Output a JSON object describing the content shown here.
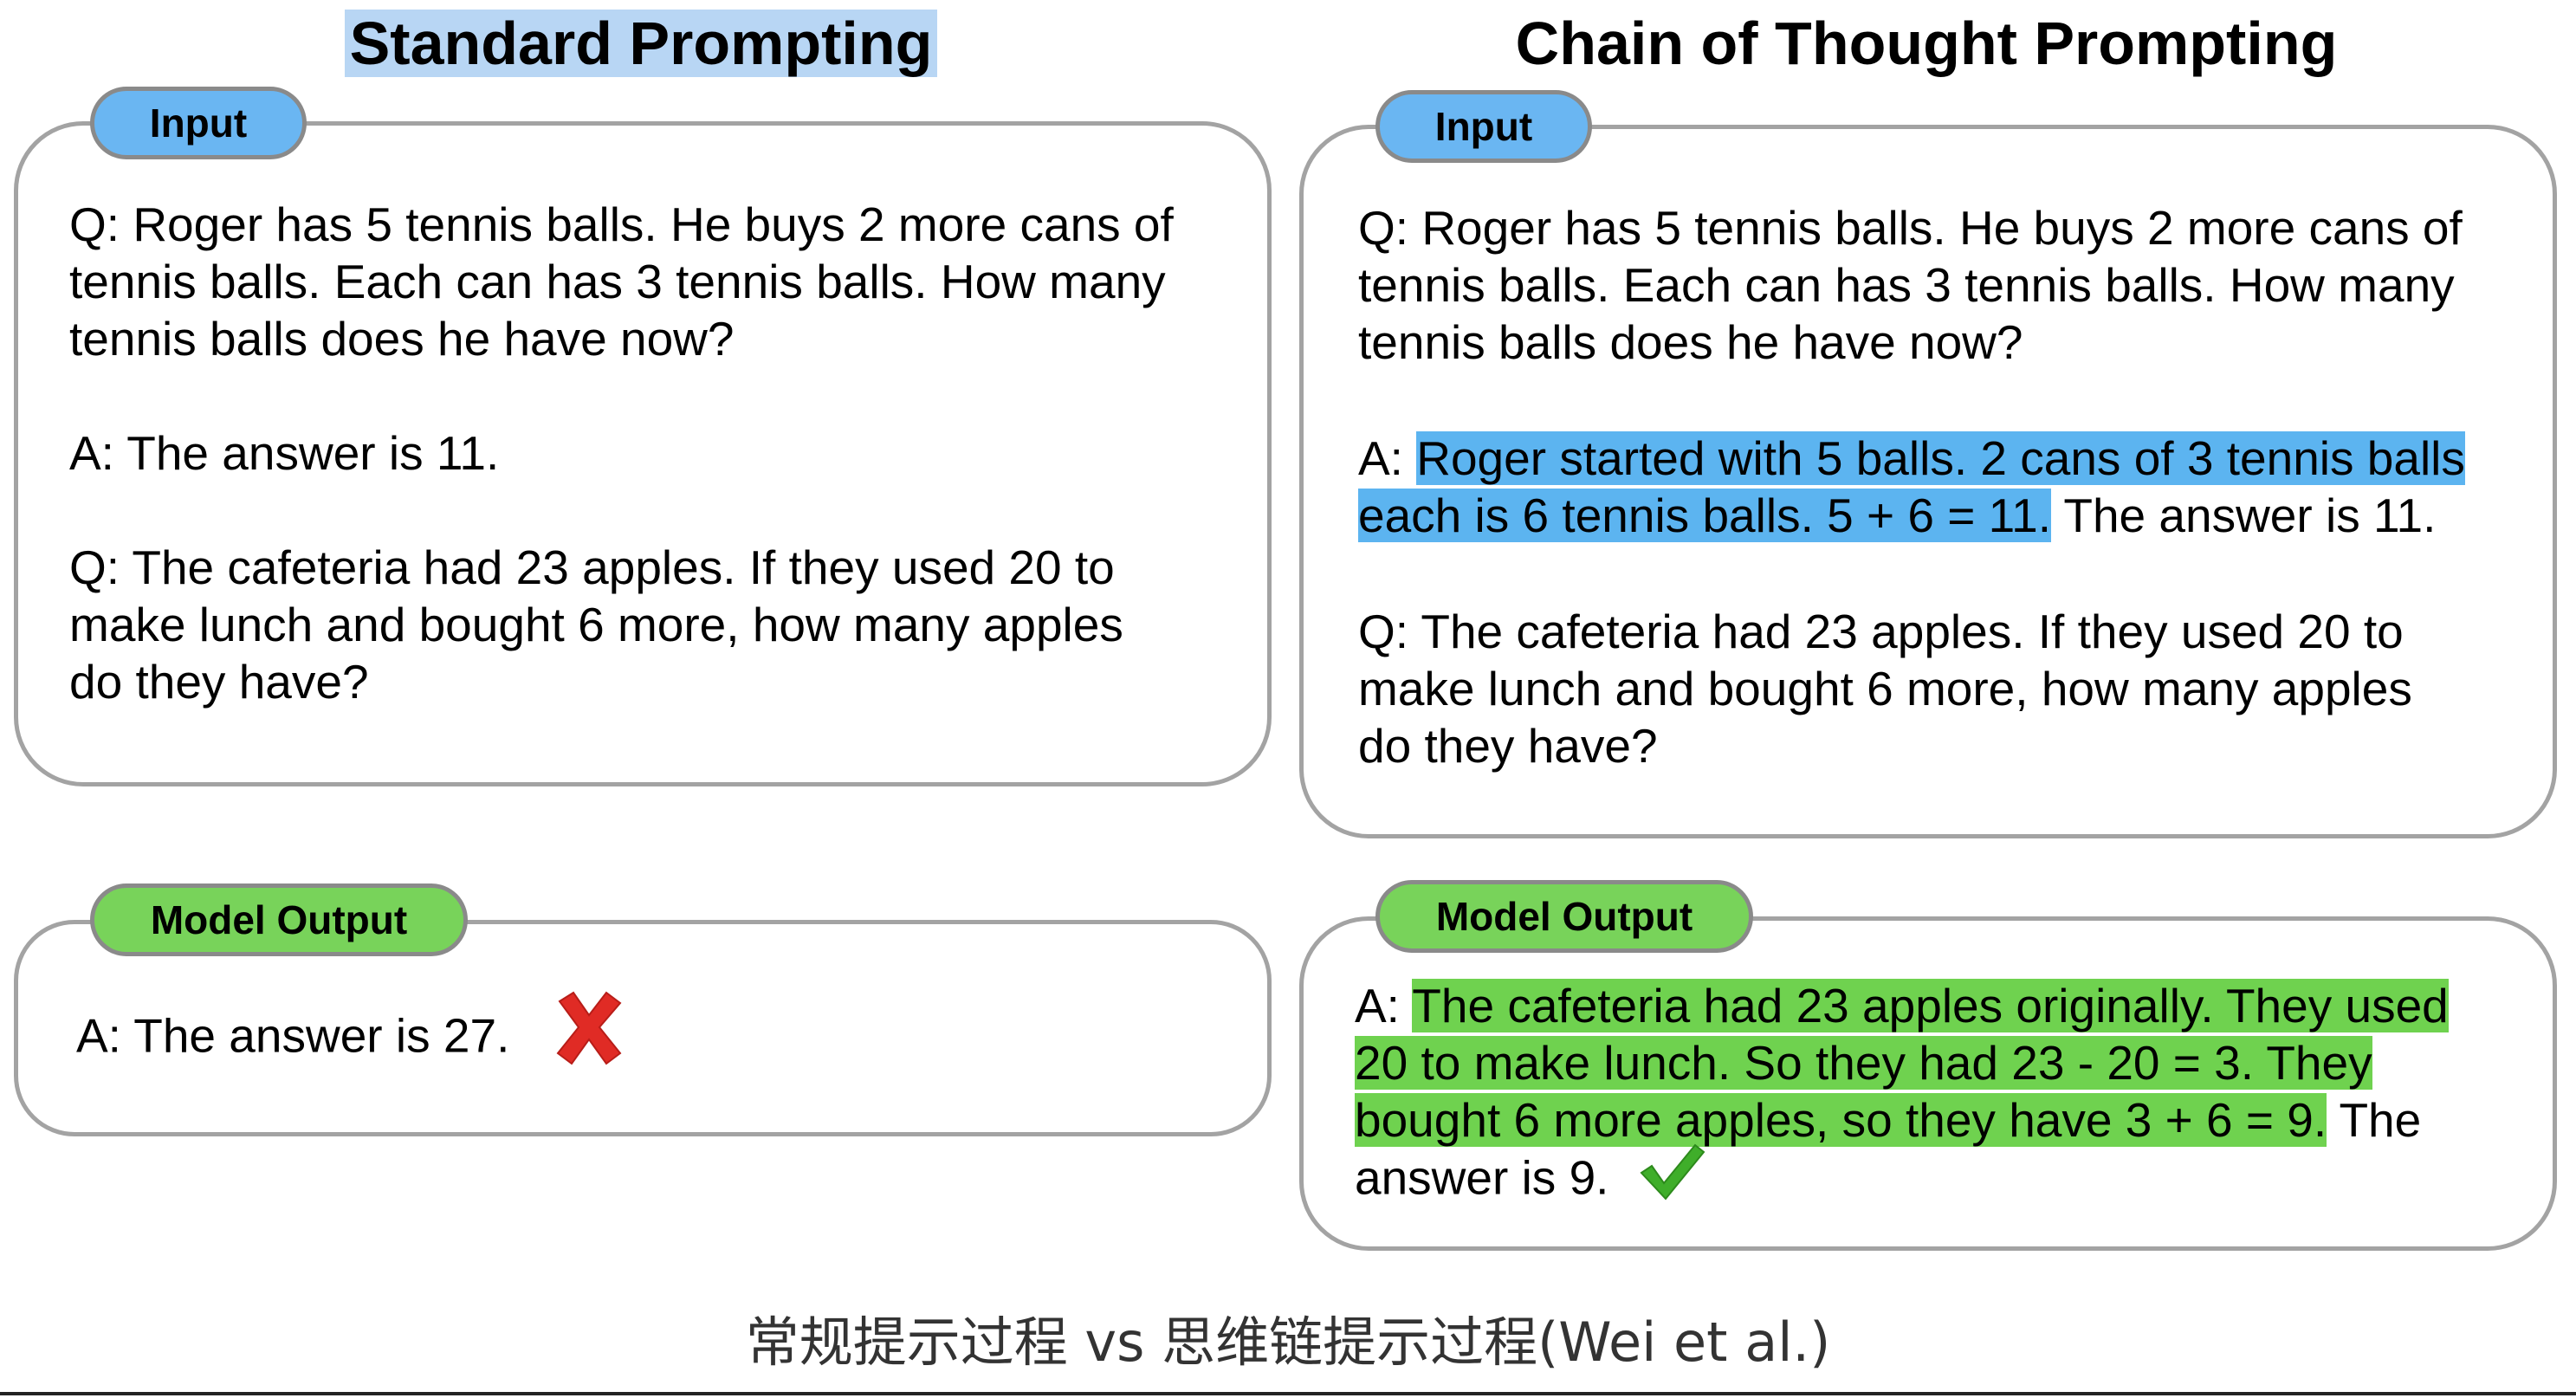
{
  "standard": {
    "heading": "Standard Prompting",
    "input_tab": "Input",
    "input_q1": [
      "Q: Roger has 5 tennis balls. He buys 2 more cans of",
      "tennis balls. Each can has 3 tennis balls. How many",
      "tennis balls does he have now?"
    ],
    "input_a1": "A: The answer is 11.",
    "input_q2": [
      "Q: The cafeteria had 23 apples. If they used 20 to",
      "make lunch and bought 6 more, how many apples",
      "do they have?"
    ],
    "output_tab": "Model Output",
    "output_text": "A: The answer is 27.",
    "output_mark": "cross-icon"
  },
  "cot": {
    "heading": "Chain of Thought Prompting",
    "input_tab": "Input",
    "input_q1": [
      "Q: Roger has 5 tennis balls. He buys 2 more cans of",
      "tennis balls. Each can has 3 tennis balls. How many",
      "tennis balls does he have now?"
    ],
    "input_a1_prefix": "A: ",
    "input_a1_reasoning_line1": "Roger started with 5 balls. 2 cans of 3 tennis balls",
    "input_a1_reasoning_line2": "each is 6 tennis balls. 5 + 6 = 11.",
    "input_a1_suffix": " The answer is 11.",
    "input_q2": [
      "Q: The cafeteria had 23 apples. If they used 20 to",
      "make lunch and bought 6 more, how many apples",
      "do they have?"
    ],
    "output_tab": "Model Output",
    "output_prefix": "A: ",
    "output_reasoning_line1": "The cafeteria had 23 apples originally. They used",
    "output_reasoning_line2": "20 to make lunch. So they had 23 - 20 = 3. They",
    "output_reasoning_line3": "bought 6 more apples, so they have 3 + 6 = 9.",
    "output_suffix_line3": " The",
    "output_suffix_line4": "answer is 9.",
    "output_mark": "check-icon"
  },
  "caption": "常规提示过程 vs 思维链提示过程(Wei et al.)",
  "colors": {
    "input_tab": "#6ab6f2",
    "output_tab": "#78d35a",
    "reasoning_highlight_input": "#5cb4f0",
    "reasoning_highlight_output": "#6fd24f",
    "heading_highlight": "#b8d6f4",
    "cross": "#e02b25",
    "check": "#3fae2a"
  }
}
